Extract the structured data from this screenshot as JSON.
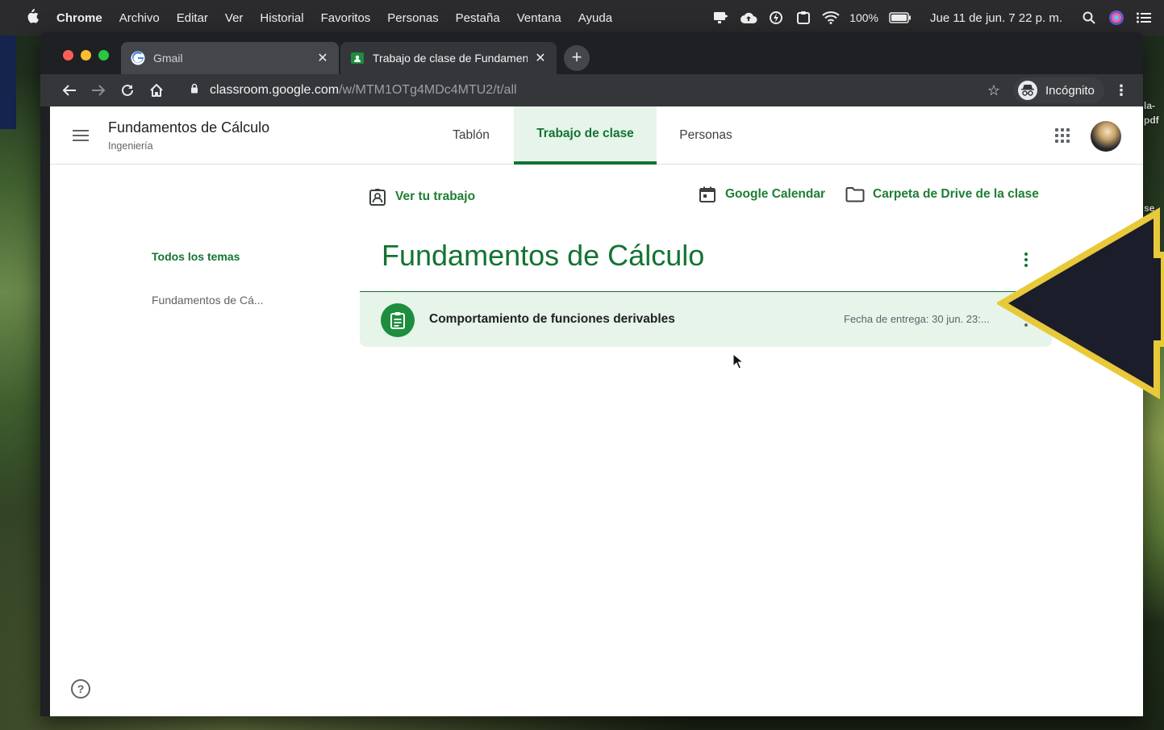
{
  "menubar": {
    "app": "Chrome",
    "items": [
      "Archivo",
      "Editar",
      "Ver",
      "Historial",
      "Favoritos",
      "Personas",
      "Pestaña",
      "Ventana",
      "Ayuda"
    ],
    "battery": "100%",
    "clock": "Jue 11 de jun. 7 22 p. m."
  },
  "browser": {
    "tabs": [
      {
        "title": "Gmail",
        "favicon": "google-g-icon"
      },
      {
        "title": "Trabajo de clase de Fundamen",
        "favicon": "classroom-icon"
      }
    ],
    "url_host": "classroom.google.com",
    "url_path": "/w/MTM1OTg4MDc4MTU2/t/all",
    "incognito_label": "Incógnito"
  },
  "desktop": {
    "side_labels": [
      "la-",
      "pdf",
      "se"
    ]
  },
  "classroom": {
    "class_name": "Fundamentos de Cálculo",
    "section": "Ingeniería",
    "tabs": [
      "Tablón",
      "Trabajo de clase",
      "Personas"
    ],
    "active_tab": "Trabajo de clase",
    "actions": {
      "view_work": "Ver tu trabajo",
      "calendar": "Google Calendar",
      "drive": "Carpeta de Drive de la clase"
    },
    "topics": {
      "all": "Todos los temas",
      "items": [
        "Fundamentos de Cá..."
      ]
    },
    "topic_section": {
      "title": "Fundamentos de Cálculo",
      "assignments": [
        {
          "title": "Comportamiento de funciones derivables",
          "due": "Fecha de entrega: 30 jun. 23:..."
        }
      ]
    },
    "help_icon": "?"
  },
  "colors": {
    "accent": "#137333",
    "accent_bg": "#e6f4ea",
    "annotation": "#e8c93a"
  }
}
